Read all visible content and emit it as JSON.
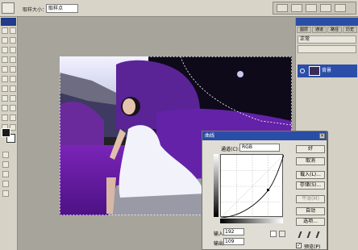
{
  "options_bar": {
    "sample_label": "取样大小：",
    "sample_value": "取样点"
  },
  "layers_panel": {
    "tabs": [
      "图层",
      "通道",
      "路径",
      "历史"
    ],
    "blend_mode": "正常",
    "layer_name": "背景"
  },
  "curves_dialog": {
    "title": "曲线",
    "channel_label": "通道(C):",
    "channel_value": "RGB",
    "input_label": "输入：",
    "input_value": "192",
    "output_label": "输出：",
    "output_value": "109",
    "buttons": {
      "ok": "好",
      "cancel": "取消",
      "load": "载入(L)...",
      "save": "存储(S)...",
      "smooth": "平滑(M)",
      "auto": "自动",
      "options": "选项..."
    },
    "preview_label": "预览(P)",
    "close_glyph": "×"
  },
  "colors": {
    "title_bar": "#2a4ea6",
    "foreground": "#1b1b1b",
    "background": "#ffffff"
  }
}
